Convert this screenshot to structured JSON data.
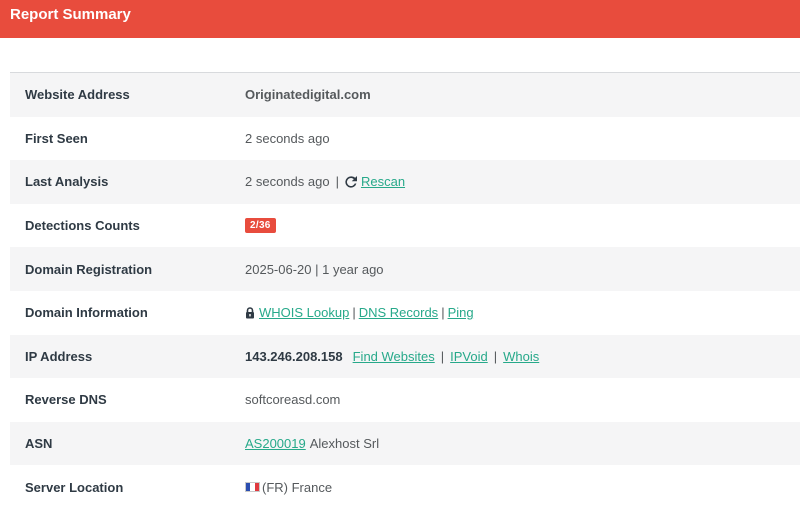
{
  "header": {
    "title": "Report Summary"
  },
  "rows": {
    "website": {
      "label": "Website Address",
      "value": "Originatedigital.com"
    },
    "first_seen": {
      "label": "First Seen",
      "value": "2 seconds ago"
    },
    "last_analysis": {
      "label": "Last Analysis",
      "value": "2 seconds ago",
      "separator": "|",
      "rescan": "Rescan",
      "rescan_icon": "refresh-icon"
    },
    "detections": {
      "label": "Detections Counts",
      "badge": "2/36",
      "badge_color": "#e84c3d"
    },
    "registration": {
      "label": "Domain Registration",
      "value": "2025-06-20 | 1 year ago"
    },
    "domain_info": {
      "label": "Domain Information",
      "lock_icon": "lock-icon",
      "whois": "WHOIS Lookup",
      "dns": "DNS Records",
      "ping": "Ping",
      "separator": "|"
    },
    "ip": {
      "label": "IP Address",
      "value": "143.246.208.158",
      "find_websites": "Find Websites",
      "ipvoid": "IPVoid",
      "whois": "Whois",
      "separator": "|"
    },
    "reverse_dns": {
      "label": "Reverse DNS",
      "value": "softcoreasd.com"
    },
    "asn": {
      "label": "ASN",
      "asn_link": "AS200019",
      "org": "Alexhost Srl"
    },
    "location": {
      "label": "Server Location",
      "flag_icon": "france-flag-icon",
      "value": "(FR) France"
    }
  },
  "colors": {
    "accent": "#e84c3d",
    "link": "#27a98a",
    "row_alt": "#f5f5f6"
  }
}
